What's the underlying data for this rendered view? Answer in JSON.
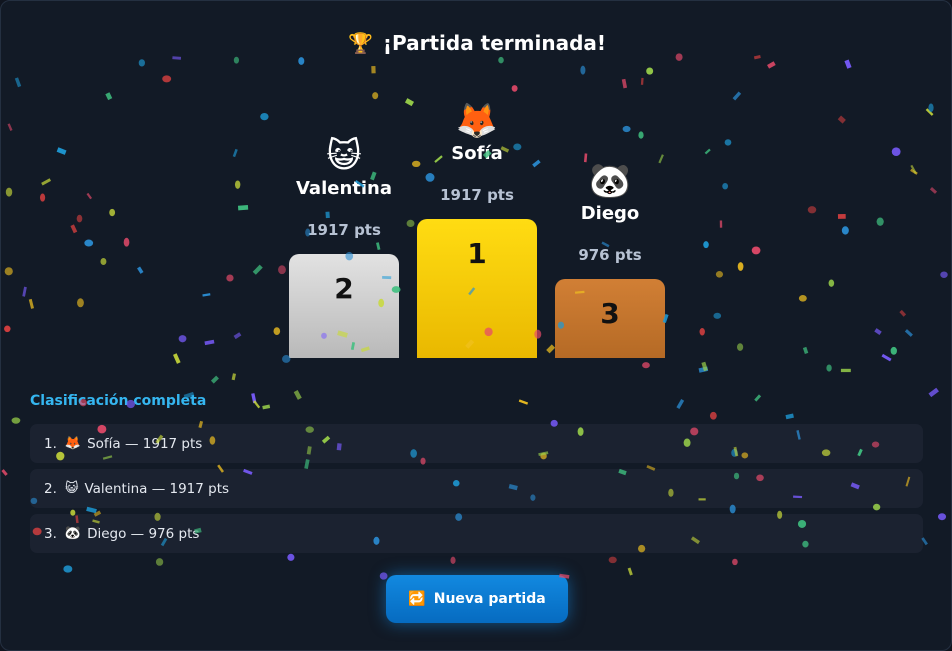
{
  "header": {
    "trophy_icon": "🏆",
    "title": "¡Partida terminada!"
  },
  "podium": {
    "first": {
      "emoji": "🦊",
      "name": "Sofía",
      "points": "1917 pts",
      "place": "1",
      "color": "#f5cc00"
    },
    "second": {
      "emoji": "😺",
      "name": "Valentina",
      "points": "1917 pts",
      "place": "2",
      "color": "#cfcfcf"
    },
    "third": {
      "emoji": "🐼",
      "name": "Diego",
      "points": "976 pts",
      "place": "3",
      "color": "#c57330"
    }
  },
  "ranking": {
    "title": "Clasificación completa",
    "rows": [
      {
        "num": "1.",
        "icon": "🦊",
        "text": "Sofía — 1917 pts"
      },
      {
        "num": "2.",
        "icon": "😺",
        "text": "Valentina — 1917 pts"
      },
      {
        "num": "3.",
        "icon": "🐼",
        "text": "Diego — 976 pts"
      }
    ]
  },
  "actions": {
    "new_game_icon": "🔁",
    "new_game_label": "Nueva partida"
  },
  "theme": {
    "accent": "#35b6f0",
    "background": "#121a26",
    "row_bg": "#1b2230",
    "button": "#0a78d0"
  }
}
